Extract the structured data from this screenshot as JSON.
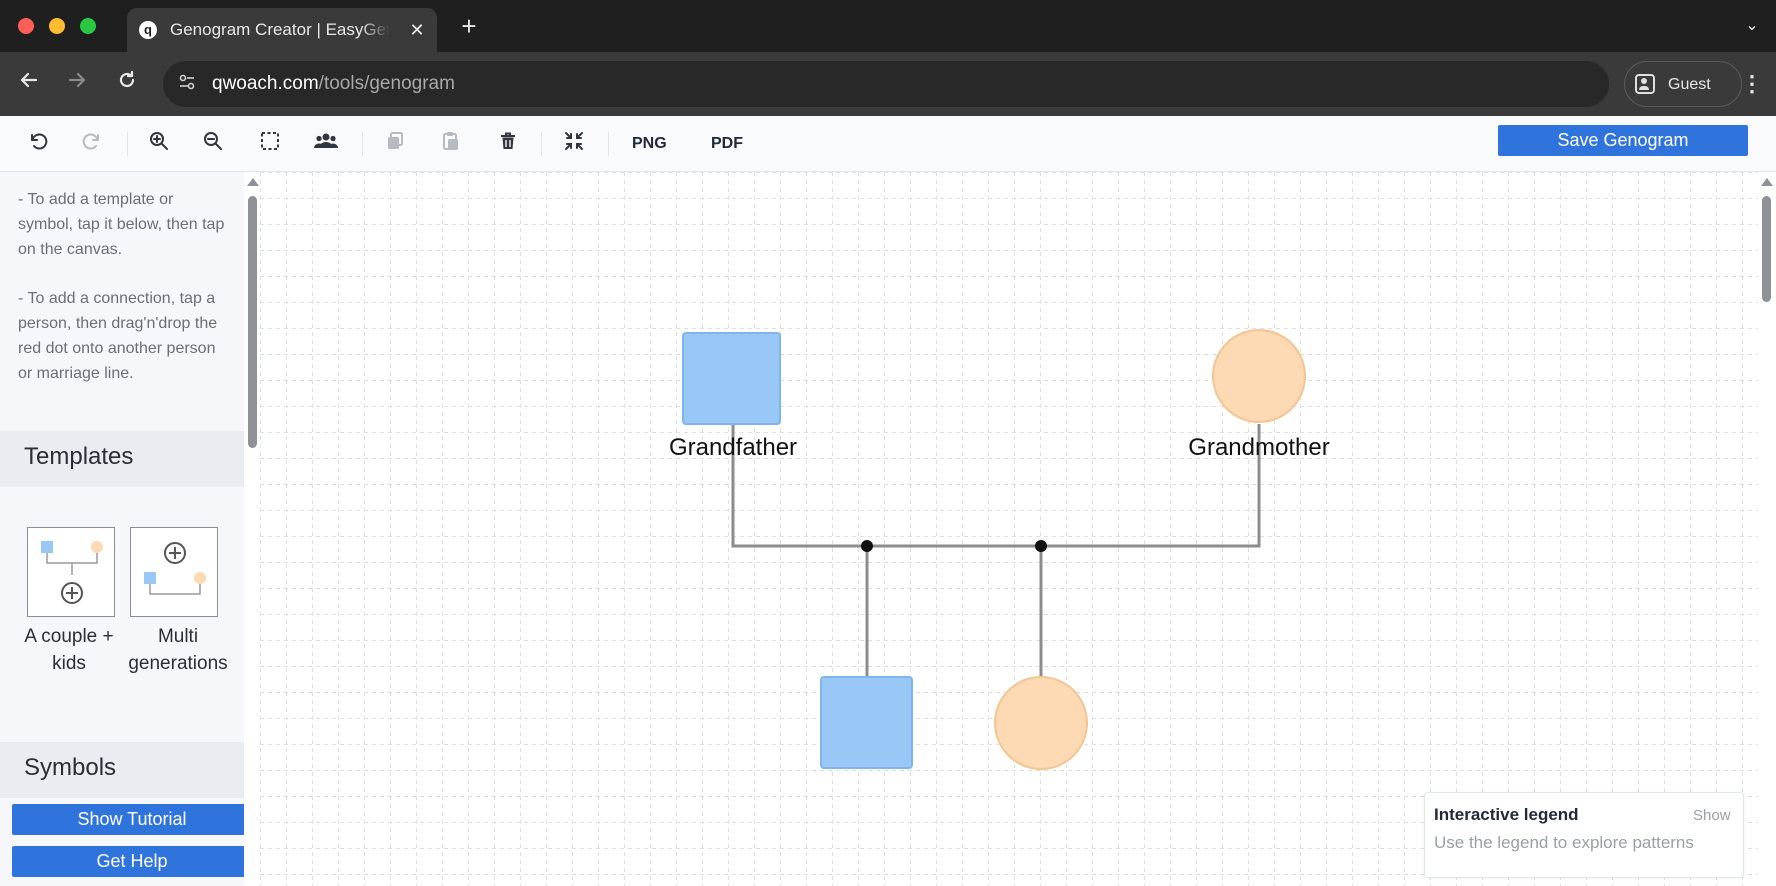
{
  "browser": {
    "tab_title": "Genogram Creator | EasyGenogram",
    "tab_favicon": "q",
    "tab_close": "✕",
    "new_tab": "+",
    "tab_menu": "⌄",
    "url_host": "qwoach.com",
    "url_path": "/tools/genogram",
    "profile_label": "Guest",
    "icons": [
      "back-icon",
      "forward-icon",
      "reload-icon",
      "site-settings-icon",
      "profile-icon",
      "menu-icon"
    ]
  },
  "toolbar": {
    "export_png": "PNG",
    "export_pdf": "PDF",
    "save_label": "Save Genogram",
    "icons": [
      "undo-icon",
      "redo-icon",
      "zoom-in-icon",
      "zoom-out-icon",
      "select-area-icon",
      "group-icon",
      "copy-icon",
      "paste-icon",
      "delete-icon",
      "fit-screen-icon"
    ],
    "accent": "#2f74dc"
  },
  "sidebar": {
    "help_1": "- To add a template or symbol, tap it below, then tap on the canvas.",
    "help_2": "- To add a connection, tap a person, then drag'n'drop the red dot onto another person or marriage line.",
    "templates_heading": "Templates",
    "templates": [
      {
        "label": "A couple + kids"
      },
      {
        "label": "Multi generations"
      }
    ],
    "symbols_heading": "Symbols",
    "show_tutorial": "Show Tutorial",
    "get_help": "Get Help"
  },
  "genogram": {
    "male_color": "#99c8f7",
    "female_color": "#fdd9b4",
    "people": [
      {
        "label": "Grandfather",
        "sex": "male"
      },
      {
        "label": "Grandmother",
        "sex": "female"
      },
      {
        "label": "",
        "sex": "male"
      },
      {
        "label": "",
        "sex": "female"
      }
    ]
  },
  "legend": {
    "title": "Interactive legend",
    "toggle": "Show",
    "subtitle": "Use the legend to explore patterns"
  }
}
